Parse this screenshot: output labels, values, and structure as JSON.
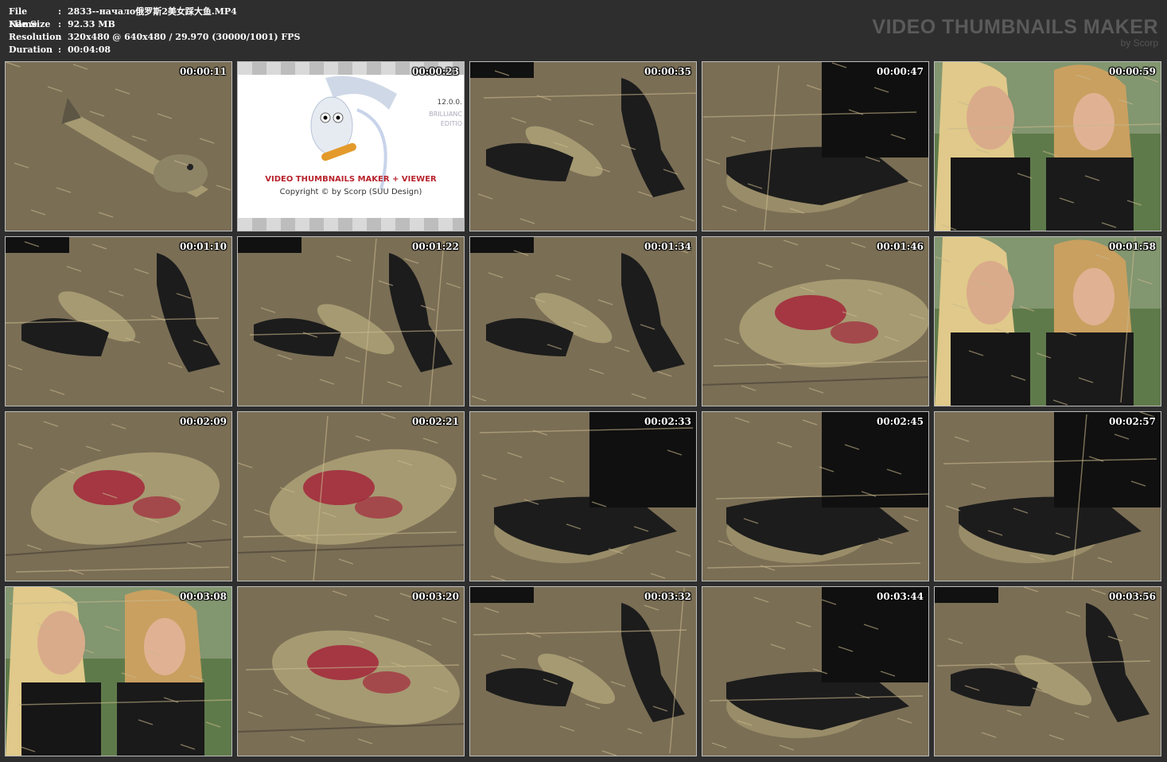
{
  "header": {
    "file_name_label": "File Name",
    "file_name_value": "2833--начало俄罗斯2美女踩大鱼.MP4",
    "file_size_label": "File Size",
    "file_size_value": "92.33 MB",
    "resolution_label": "Resolution",
    "resolution_value": "320x480 @ 640x480 / 29.970 (30000/1001) FPS",
    "duration_label": "Duration",
    "duration_value": "00:04:08",
    "separator": ":"
  },
  "brand": {
    "title": "VIDEO THUMBNAILS MAKER",
    "subtitle": "by Scorp"
  },
  "splash": {
    "caption": "VIDEO THUMBNAILS MAKER + VIEWER",
    "copyright": "Copyright © by Scorp (SUU Design)",
    "version": "12.0.0.",
    "edition_1": "BRILLIANC",
    "edition_2": "EDITIO"
  },
  "thumbnails": [
    {
      "time": "00:00:11",
      "scene": "fish-ground"
    },
    {
      "time": "00:00:23",
      "scene": "splash"
    },
    {
      "time": "00:00:35",
      "scene": "shoes-fish"
    },
    {
      "time": "00:00:47",
      "scene": "shoe-close"
    },
    {
      "time": "00:00:59",
      "scene": "people"
    },
    {
      "time": "00:01:10",
      "scene": "shoes-fish"
    },
    {
      "time": "00:01:22",
      "scene": "shoes-fish"
    },
    {
      "time": "00:01:34",
      "scene": "shoes-fish"
    },
    {
      "time": "00:01:46",
      "scene": "fish-close"
    },
    {
      "time": "00:01:58",
      "scene": "people"
    },
    {
      "time": "00:02:09",
      "scene": "fish-close"
    },
    {
      "time": "00:02:21",
      "scene": "fish-close"
    },
    {
      "time": "00:02:33",
      "scene": "shoe-close"
    },
    {
      "time": "00:02:45",
      "scene": "shoe-close"
    },
    {
      "time": "00:02:57",
      "scene": "shoe-close"
    },
    {
      "time": "00:03:08",
      "scene": "people"
    },
    {
      "time": "00:03:20",
      "scene": "fish-close"
    },
    {
      "time": "00:03:32",
      "scene": "shoes-fish"
    },
    {
      "time": "00:03:44",
      "scene": "shoe-close"
    },
    {
      "time": "00:03:56",
      "scene": "shoes-fish"
    }
  ],
  "colors": {
    "background": "#2e2e2e",
    "ground": "#7a6e55",
    "fish": "#a69a72",
    "blood": "#a3263a",
    "shoe": "#1c1c1c",
    "hair": "#e0c98a",
    "foliage": "#5f7a4a"
  }
}
